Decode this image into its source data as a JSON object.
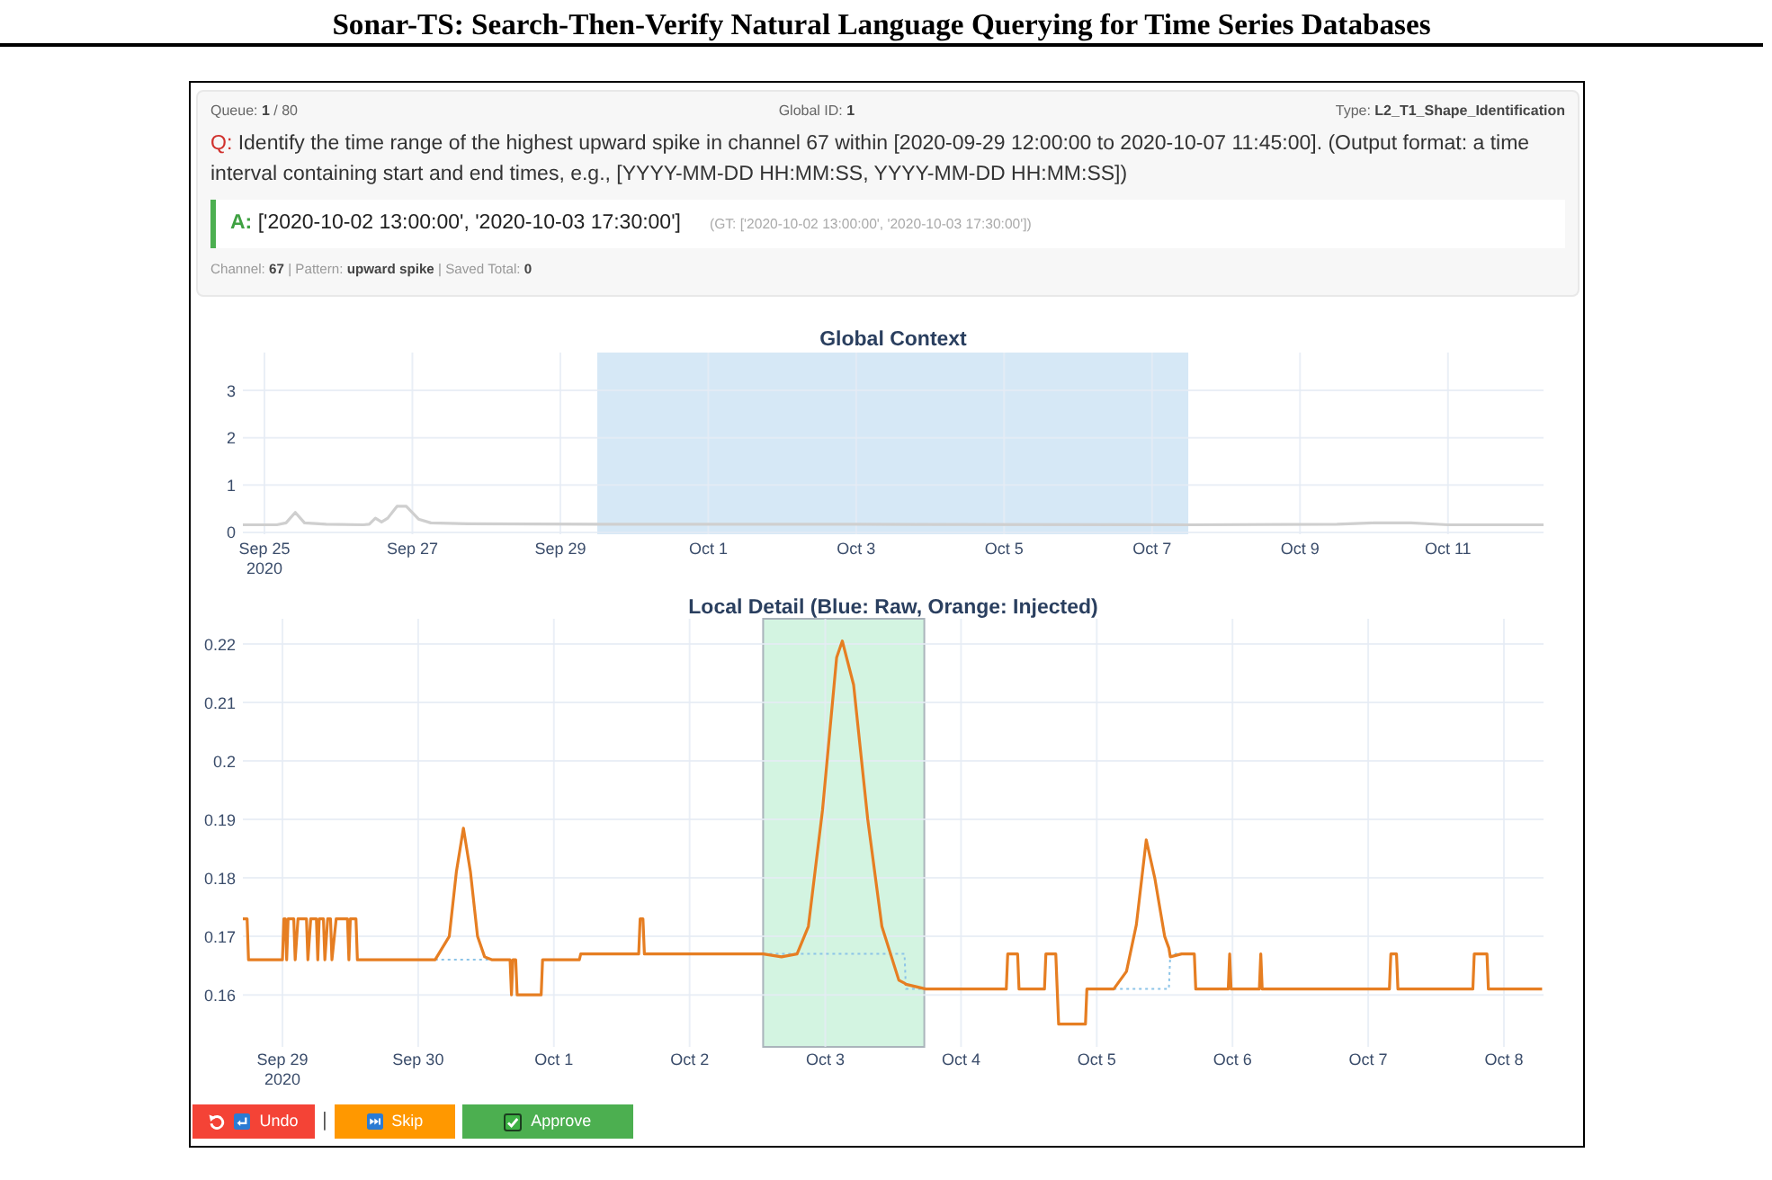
{
  "paper_title": "Sonar-TS: Search-Then-Verify Natural Language Querying for Time Series Databases",
  "panel": {
    "meta": {
      "queue": "Queue: **1** / 80",
      "global_id": "Global ID: **1**",
      "type": "Type: **L2_T1_Shape_Identification**"
    },
    "question": {
      "prefix": "Q:",
      "text": "Identify the time range of the highest upward spike in channel 67 within [2020-09-29 12:00:00 to 2020-10-07 11:45:00]. (Output format: a time interval containing start and end times, e.g., [YYYY-MM-DD HH:MM:SS, YYYY-MM-DD HH:MM:SS])"
    },
    "answer": {
      "prefix": "A:",
      "text": "['2020-10-02 13:00:00', '2020-10-03 17:30:00']",
      "ground_truth": "(GT: ['2020-10-02 13:00:00', '2020-10-03 17:30:00'])"
    },
    "details": "Channel: **67** | Pattern: **upward spike** | Saved Total: **0**"
  },
  "global_chart": {
    "chart_data": {
      "type": "line",
      "title": "Global Context",
      "grid": true,
      "x": [
        "2020-09-24 17:00",
        "2020-09-25 04:00",
        "2020-09-25 07:00",
        "2020-09-25 10:00",
        "2020-09-25 13:00",
        "2020-09-25 20:00",
        "2020-09-26 08:00",
        "2020-09-26 10:00",
        "2020-09-26 12:00",
        "2020-09-26 14:00",
        "2020-09-26 16:00",
        "2020-09-26 19:00",
        "2020-09-26 22:00",
        "2020-09-27 02:00",
        "2020-09-27 06:00",
        "2020-09-27 18:00",
        "2020-09-29 12:00",
        "2020-10-03 00:00",
        "2020-10-07 12:00",
        "2020-10-09 12:00",
        "2020-10-10 00:00",
        "2020-10-10 12:00",
        "2020-10-11 00:00",
        "2020-10-12 07:00"
      ],
      "series": [
        {
          "color": "#cfcfcf",
          "values": [
            0.16,
            0.16,
            0.2,
            0.42,
            0.2,
            0.17,
            0.16,
            0.17,
            0.3,
            0.22,
            0.3,
            0.55,
            0.55,
            0.28,
            0.2,
            0.18,
            0.17,
            0.17,
            0.16,
            0.17,
            0.2,
            0.2,
            0.16,
            0.16
          ]
        }
      ],
      "xlim": [
        "2020-09-24 17:00",
        "2020-10-12 07:00"
      ],
      "ylim": [
        -0.04,
        3.8
      ],
      "xticks": [
        {
          "value": "2020-09-25",
          "label": "Sep 25\n2020"
        },
        {
          "value": "2020-09-27",
          "label": "Sep 27"
        },
        {
          "value": "2020-09-29",
          "label": "Sep 29"
        },
        {
          "value": "2020-10-01",
          "label": "Oct 1"
        },
        {
          "value": "2020-10-03",
          "label": "Oct 3"
        },
        {
          "value": "2020-10-05",
          "label": "Oct 5"
        },
        {
          "value": "2020-10-07",
          "label": "Oct 7"
        },
        {
          "value": "2020-10-09",
          "label": "Oct 9"
        },
        {
          "value": "2020-10-11",
          "label": "Oct 11"
        }
      ],
      "yticks": [
        0,
        1,
        2,
        3
      ],
      "bands": [
        {
          "axis": "x",
          "from": "2020-09-29 12:00",
          "to": "2020-10-07 11:45",
          "color": "#d6e8f6"
        }
      ]
    }
  },
  "local_chart": {
    "chart_data": {
      "type": "line",
      "title": "Local Detail (Blue: Raw, Orange: Injected)",
      "grid": true,
      "x": [
        "2020-09-28 17:00",
        "2020-09-28 17:45",
        "2020-09-28 18:00",
        "2020-09-29 00:00",
        "2020-09-29 00:15",
        "2020-09-29 00:30",
        "2020-09-29 00:45",
        "2020-09-29 01:00",
        "2020-09-29 02:00",
        "2020-09-29 02:15",
        "2020-09-29 02:45",
        "2020-09-29 04:15",
        "2020-09-29 04:30",
        "2020-09-29 05:00",
        "2020-09-29 06:00",
        "2020-09-29 06:15",
        "2020-09-29 06:30",
        "2020-09-29 07:15",
        "2020-09-29 07:30",
        "2020-09-29 08:00",
        "2020-09-29 08:30",
        "2020-09-29 08:45",
        "2020-09-29 09:30",
        "2020-09-29 11:30",
        "2020-09-29 11:45",
        "2020-09-29 12:00",
        "2020-09-29 13:00",
        "2020-09-29 13:15",
        "2020-09-30 03:00",
        "2020-09-30 05:30",
        "2020-09-30 06:45",
        "2020-09-30 08:00",
        "2020-09-30 09:15",
        "2020-09-30 10:30",
        "2020-09-30 11:45",
        "2020-09-30 13:00",
        "2020-09-30 16:15",
        "2020-09-30 16:30",
        "2020-09-30 16:45",
        "2020-09-30 17:15",
        "2020-09-30 17:30",
        "2020-09-30 21:45",
        "2020-09-30 22:00",
        "2020-10-01 04:30",
        "2020-10-01 04:45",
        "2020-10-01 15:00",
        "2020-10-01 15:15",
        "2020-10-01 15:45",
        "2020-10-01 16:00",
        "2020-10-02 13:00",
        "2020-10-02 16:15",
        "2020-10-02 19:00",
        "2020-10-02 21:00",
        "2020-10-02 23:30",
        "2020-10-03 02:00",
        "2020-10-03 03:00",
        "2020-10-03 05:00",
        "2020-10-03 07:30",
        "2020-10-03 10:00",
        "2020-10-03 13:00",
        "2020-10-03 14:00",
        "2020-10-03 14:15",
        "2020-10-03 17:45",
        "2020-10-04 08:00",
        "2020-10-04 08:15",
        "2020-10-04 10:00",
        "2020-10-04 10:15",
        "2020-10-04 14:45",
        "2020-10-04 15:00",
        "2020-10-04 16:45",
        "2020-10-04 17:00",
        "2020-10-04 17:15",
        "2020-10-04 22:00",
        "2020-10-04 22:15",
        "2020-10-05 03:00",
        "2020-10-05 05:15",
        "2020-10-05 07:00",
        "2020-10-05 08:45",
        "2020-10-05 10:15",
        "2020-10-05 12:00",
        "2020-10-05 12:45",
        "2020-10-05 13:00",
        "2020-10-05 15:00",
        "2020-10-05 17:15",
        "2020-10-05 17:30",
        "2020-10-05 23:15",
        "2020-10-05 23:30",
        "2020-10-05 23:45",
        "2020-10-06 04:45",
        "2020-10-06 05:00",
        "2020-10-06 05:15",
        "2020-10-07 03:45",
        "2020-10-07 04:00",
        "2020-10-07 05:00",
        "2020-10-07 05:15",
        "2020-10-07 18:30",
        "2020-10-07 18:45",
        "2020-10-07 21:00",
        "2020-10-07 21:15",
        "2020-10-08 06:45"
      ],
      "series": [
        {
          "color": "#8cc4e8",
          "line_style": "dotted",
          "values": [
            null,
            null,
            null,
            null,
            null,
            null,
            null,
            null,
            null,
            null,
            null,
            null,
            null,
            null,
            null,
            null,
            null,
            null,
            null,
            null,
            null,
            null,
            null,
            null,
            null,
            null,
            null,
            null,
            0.166,
            0.166,
            0.166,
            0.166,
            0.166,
            0.166,
            0.166,
            0.166,
            null,
            null,
            null,
            null,
            null,
            null,
            null,
            null,
            null,
            null,
            null,
            null,
            null,
            0.167,
            0.167,
            0.167,
            0.167,
            0.167,
            0.167,
            0.167,
            0.167,
            0.167,
            0.167,
            0.167,
            0.167,
            0.161,
            0.161,
            null,
            null,
            null,
            null,
            null,
            null,
            null,
            null,
            null,
            null,
            null,
            0.161,
            0.161,
            0.161,
            0.161,
            0.161,
            0.161,
            0.161,
            0.167,
            0.167,
            null,
            null,
            null,
            null,
            null,
            null,
            null,
            null,
            null,
            null,
            null,
            null,
            null,
            null,
            null,
            null,
            null
          ]
        },
        {
          "color": "#e67e22",
          "values": [
            0.173,
            0.173,
            0.166,
            0.166,
            0.173,
            0.173,
            0.166,
            0.173,
            0.173,
            0.166,
            0.173,
            0.173,
            0.166,
            0.173,
            0.173,
            0.166,
            0.173,
            0.173,
            0.166,
            0.173,
            0.173,
            0.166,
            0.173,
            0.173,
            0.166,
            0.173,
            0.173,
            0.166,
            0.166,
            0.17,
            0.181,
            0.1885,
            0.181,
            0.17,
            0.1665,
            0.166,
            0.166,
            0.16,
            0.166,
            0.166,
            0.16,
            0.16,
            0.166,
            0.166,
            0.167,
            0.167,
            0.173,
            0.173,
            0.167,
            0.167,
            0.1665,
            0.167,
            0.1717,
            0.1916,
            0.2177,
            0.2205,
            0.213,
            0.19,
            0.1717,
            0.1625,
            0.162,
            0.1618,
            0.161,
            0.161,
            0.167,
            0.167,
            0.161,
            0.161,
            0.167,
            0.167,
            0.161,
            0.155,
            0.155,
            0.161,
            0.161,
            0.164,
            0.172,
            0.1865,
            0.18,
            0.17,
            0.168,
            0.1665,
            0.167,
            0.167,
            0.161,
            0.161,
            0.167,
            0.161,
            0.161,
            0.167,
            0.161,
            0.161,
            0.167,
            0.167,
            0.161,
            0.161,
            0.167,
            0.167,
            0.161,
            0.161
          ]
        }
      ],
      "xlim": [
        "2020-09-28 17:00",
        "2020-10-08 07:00"
      ],
      "ylim": [
        0.1511,
        0.2243
      ],
      "xticks": [
        {
          "value": "2020-09-29",
          "label": "Sep 29\n2020"
        },
        {
          "value": "2020-09-30",
          "label": "Sep 30"
        },
        {
          "value": "2020-10-01",
          "label": "Oct 1"
        },
        {
          "value": "2020-10-02",
          "label": "Oct 2"
        },
        {
          "value": "2020-10-03",
          "label": "Oct 3"
        },
        {
          "value": "2020-10-04",
          "label": "Oct 4"
        },
        {
          "value": "2020-10-05",
          "label": "Oct 5"
        },
        {
          "value": "2020-10-06",
          "label": "Oct 6"
        },
        {
          "value": "2020-10-07",
          "label": "Oct 7"
        },
        {
          "value": "2020-10-08",
          "label": "Oct 8"
        }
      ],
      "yticks": [
        0.16,
        0.17,
        0.18,
        0.19,
        0.2,
        0.21,
        0.22
      ],
      "bands": [
        {
          "axis": "x",
          "from": "2020-10-02 13:00",
          "to": "2020-10-03 17:30",
          "color": "#d3f4e1"
        }
      ]
    }
  },
  "toolbar": [
    {
      "kind": "undo",
      "label": "Undo"
    },
    {
      "kind": "separator",
      "text": "|"
    },
    {
      "kind": "skip",
      "label": "Skip"
    },
    {
      "kind": "approve",
      "label": "Approve"
    }
  ]
}
